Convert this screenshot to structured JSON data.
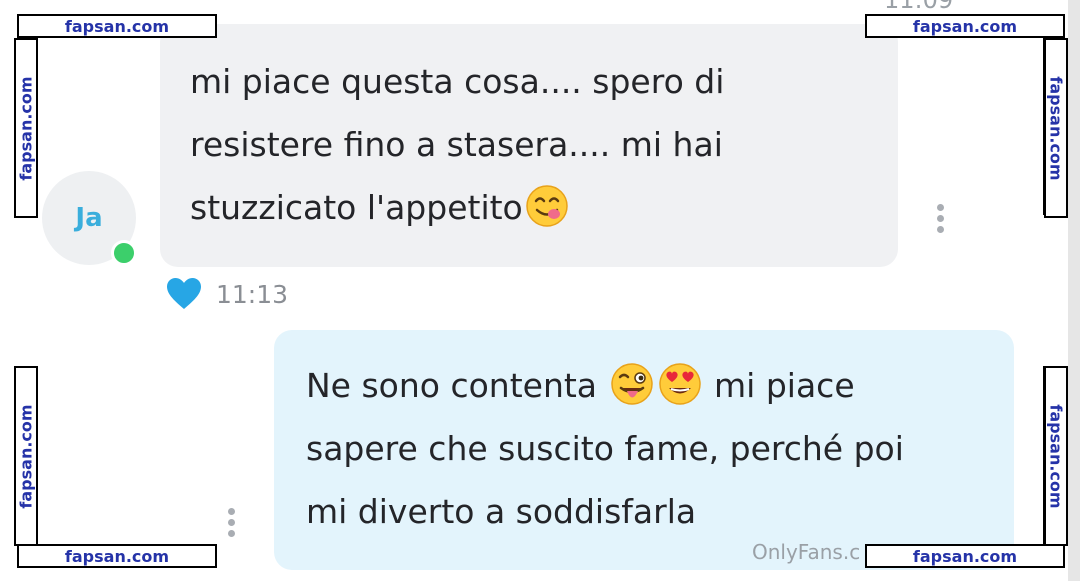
{
  "chat": {
    "top_fragment": "11:09",
    "incoming": {
      "avatar_initials": "Ja",
      "text_parts": [
        "mi piace questa cosa.... spero di\nresistere fino a stasera.... mi hai\nstuzzicato l'appetito"
      ],
      "emoji": "yum-emoji",
      "time": "11:13",
      "liked": true
    },
    "outgoing": {
      "line1_a": "Ne sono contenta",
      "line1_b": "mi piace",
      "rest": "sapere che suscito fame, perché poi\nmi diverto a soddisfarla",
      "emojis": [
        "winking-tongue-emoji",
        "heart-eyes-emoji"
      ]
    },
    "platform_watermark": "OnlyFans.c"
  },
  "watermarks": {
    "site": "fapsan.com"
  },
  "colors": {
    "incoming_bubble": "#f0f1f3",
    "outgoing_bubble": "#e3f4fc",
    "heart": "#27a6e5",
    "online": "#3ccf6b",
    "watermark_text": "#2533a8"
  }
}
